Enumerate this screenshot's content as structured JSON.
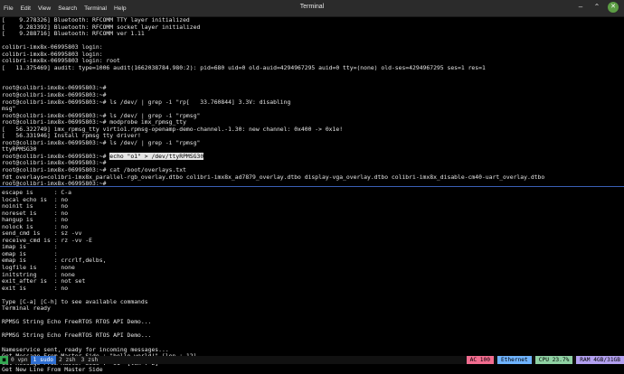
{
  "window": {
    "title": "Terminal",
    "menu": [
      "File",
      "Edit",
      "View",
      "Search",
      "Terminal",
      "Help"
    ]
  },
  "terminal_top": [
    "[    9.278326] Bluetooth: RFCOMM TTY layer initialized",
    "[    9.283392] Bluetooth: RFCOMM socket layer initialized",
    "[    9.288716] Bluetooth: RFCOMM ver 1.11",
    "",
    "colibri-imx8x-06995803 login:",
    "colibri-imx8x-06995803 login:",
    "colibri-imx8x-06995803 login: root",
    "[   11.375469] audit: type=1006 audit(1662038784.980:2): pid=680 uid=0 old-auid=4294967295 auid=0 tty=(none) old-ses=4294967295 ses=1 res=1",
    "",
    "",
    "root@colibri-imx8x-06995803:~#",
    "root@colibri-imx8x-06995803:~#",
    "root@colibri-imx8x-06995803:~# ls /dev/ | grep -i \"rp[   33.760844] 3.3V: disabling",
    "msg\"",
    "root@colibri-imx8x-06995803:~# ls /dev/ | grep -i \"rpmsg\"",
    "root@colibri-imx8x-06995803:~# modprobe imx_rpmsg_tty",
    "[   56.322749] imx_rpmsg_tty virtio1.rpmsg-openamp-demo-channel.-1.30: new channel: 0x400 -> 0x1e!",
    "[   56.331946] Install rpmsg tty driver!",
    "root@colibri-imx8x-06995803:~# ls /dev/ | grep -i \"rpmsg\"",
    "ttyRPMSG30",
    "root@colibri-imx8x-06995803:~# echo \"o1\" > /dev/ttyRPMSG30",
    "root@colibri-imx8x-06995803:~#",
    "root@colibri-imx8x-06995803:~# cat /boot/overlays.txt",
    "fdt_overlays=colibri-imx8x_parallel-rgb_overlay.dtbo colibri-imx8x_ad7879_overlay.dtbo display-vga_overlay.dtbo colibri-imx8x_disable-cm40-uart_overlay.dtbo",
    "root@colibri-imx8x-06995803:~#"
  ],
  "highlight": {
    "line": 20,
    "prefix": "root@colibri-imx8x-06995803:~# ",
    "text": "echo \"o1\" > /dev/ttyRPMSG30"
  },
  "terminal_bottom": [
    "escape is      : C-a",
    "local echo is  : no",
    "noinit is      : no",
    "noreset is     : no",
    "hangup is      : no",
    "nolock is      : no",
    "send_cmd is    : sz -vv",
    "receive_cmd is : rz -vv -E",
    "imap is        :",
    "omap is        :",
    "emap is        : crcrlf,delbs,",
    "logfile is     : none",
    "initstring     : none",
    "exit_after is  : not set",
    "exit is        : no",
    "",
    "Type [C-a] [C-h] to see available commands",
    "Terminal ready",
    "",
    "RPMSG String Echo FreeRTOS RTOS API Demo...",
    "",
    "RPMSG String Echo FreeRTOS RTOS API Demo...",
    "",
    "Nameservice sent, ready for incoming messages...",
    "Get Message From Master Side : \"hello world!\" [len : 12]",
    "Get Message From Master Side : \"o1\" [len : 2]",
    "Get New Line From Master Side"
  ],
  "statusbar": {
    "workspaces": [
      {
        "label": "0 vpn",
        "active": false
      },
      {
        "label": "1 sudo",
        "active": true
      },
      {
        "label": "2 zsh",
        "active": false
      },
      {
        "label": "3 zsh",
        "active": false
      }
    ],
    "ac": "AC 100",
    "network": "Ethernet",
    "cpu": "CPU 23.7%",
    "ram": "RAM 4GB/31GB"
  },
  "colors": {
    "titlebar": "#2b2b2b",
    "background": "#000000",
    "text": "#e6e6e6",
    "close_button": "#5c9d44",
    "divider": "#3a5fb5",
    "ws_active": "#2f6fd1",
    "ac": "#f26c8f",
    "ethernet": "#6fb3ff",
    "cpu": "#8fd1a3",
    "ram": "#b3a0f0"
  }
}
